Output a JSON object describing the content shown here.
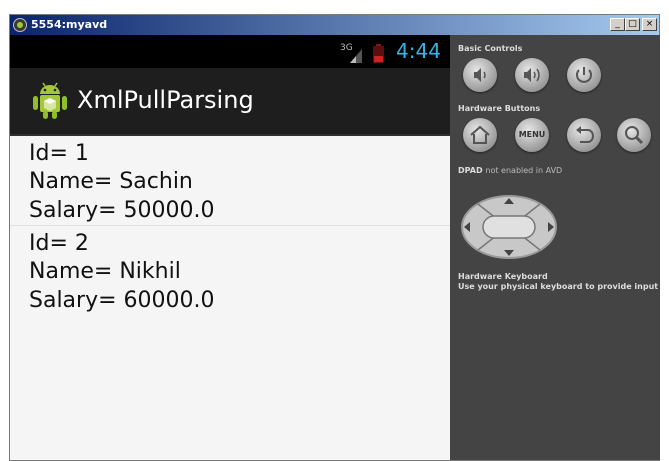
{
  "window": {
    "title": "5554:myavd",
    "buttons": {
      "minimize": "_",
      "maximize": "□",
      "close": "×"
    }
  },
  "status_bar": {
    "network_label": "3G",
    "time": "4:44",
    "clock_color": "#33b5e5"
  },
  "action_bar": {
    "app_title": "XmlPullParsing",
    "icon": "android-robot-icon"
  },
  "employees": [
    {
      "id": "Id= 1",
      "name": "Name= Sachin",
      "salary": "Salary= 50000.0"
    },
    {
      "id": "Id= 2",
      "name": "Name= Nikhil",
      "salary": "Salary= 60000.0"
    }
  ],
  "panel": {
    "basic_controls_label": "Basic Controls",
    "basic_controls": [
      "volume-down-icon",
      "volume-up-icon",
      "power-icon"
    ],
    "hardware_buttons_label": "Hardware Buttons",
    "hardware_buttons": [
      "home-icon",
      "menu-button",
      "back-icon",
      "search-icon"
    ],
    "menu_label": "MENU",
    "dpad_label": "DPAD",
    "dpad_note": "not enabled in AVD",
    "keyboard_label": "Hardware Keyboard",
    "keyboard_note": "Use your physical keyboard to provide input"
  }
}
